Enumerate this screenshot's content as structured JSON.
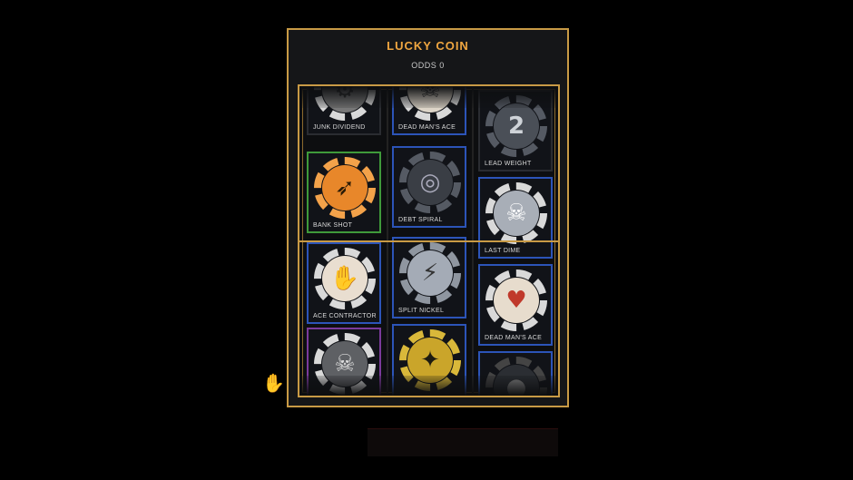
{
  "panel": {
    "title": "LUCKY COIN",
    "odds": "ODDS 0"
  },
  "colors": {
    "gold_border": "#c89a45",
    "title": "#f0a640",
    "blue_frame": "#2c54b8",
    "green_frame": "#3f9a3a",
    "purple_frame": "#7b3a9b"
  },
  "reels": [
    {
      "column": 1,
      "chips": [
        {
          "label": "JUNK DIVIDEND",
          "frame": "none",
          "icon": "gear-skull-icon"
        },
        {
          "label": "BANK SHOT",
          "frame": "green",
          "icon": "bullet-icon"
        },
        {
          "label": "ACE CONTRACTOR",
          "frame": "blue",
          "icon": "hand-print-icon"
        },
        {
          "label": "",
          "frame": "purple",
          "icon": "teeth-icon"
        }
      ]
    },
    {
      "column": 2,
      "chips": [
        {
          "label": "DEAD MAN'S ACE",
          "frame": "blue",
          "icon": "skull-icon"
        },
        {
          "label": "DEBT SPIRAL",
          "frame": "blue",
          "icon": "spiral-icon"
        },
        {
          "label": "SPLIT NICKEL",
          "frame": "blue",
          "icon": "cracked-coin-icon"
        },
        {
          "label": "",
          "frame": "blue",
          "icon": "compass-star-icon"
        }
      ]
    },
    {
      "column": 3,
      "chips": [
        {
          "label": "LEAD WEIGHT",
          "frame": "none",
          "icon": "weight-icon"
        },
        {
          "label": "LAST DIME",
          "frame": "blue",
          "icon": "skull-crossbones-icon"
        },
        {
          "label": "DEAD MAN'S ACE",
          "frame": "blue",
          "icon": "skull-card-icon"
        },
        {
          "label": "",
          "frame": "blue",
          "icon": "chip-icon"
        }
      ]
    }
  ]
}
